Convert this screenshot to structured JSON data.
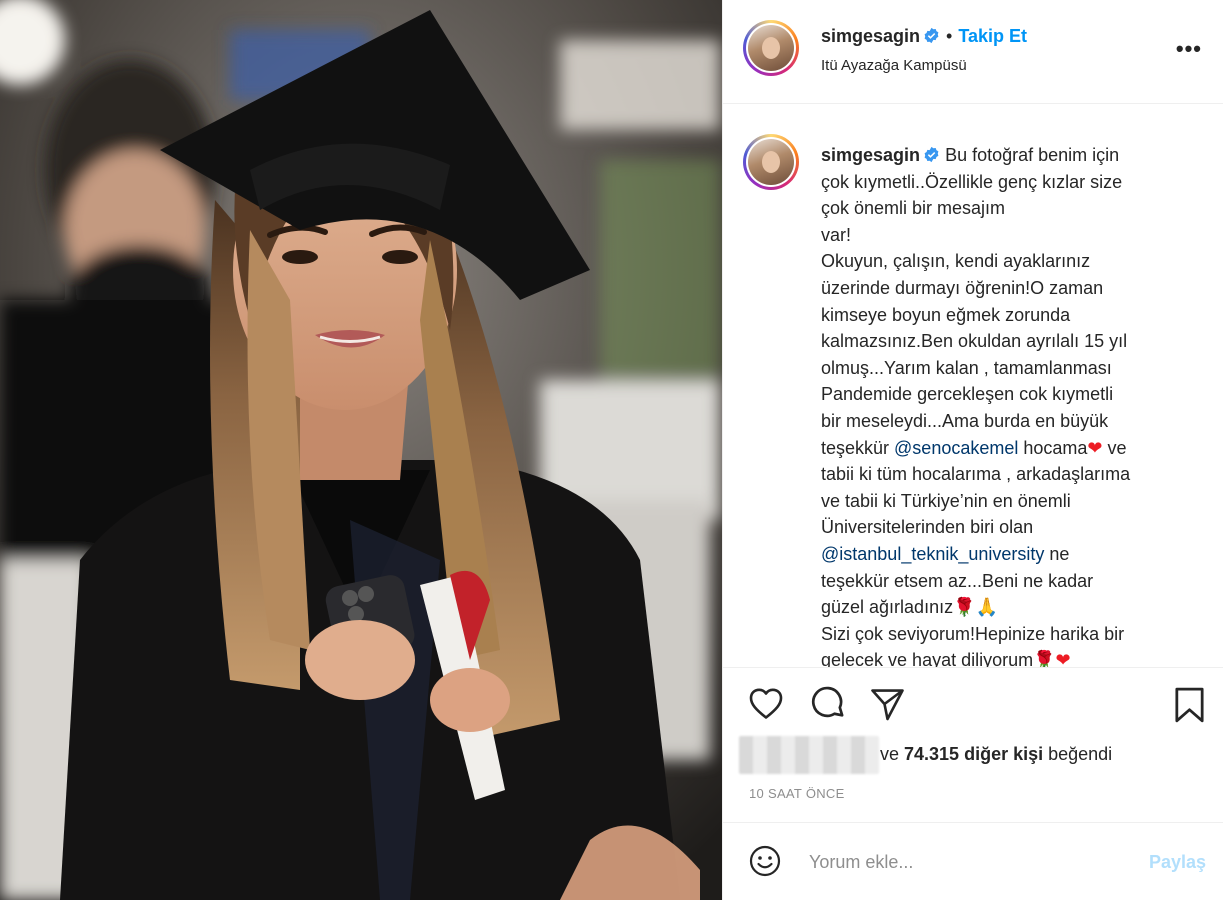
{
  "post": {
    "username": "simgesagin",
    "verified": true,
    "dot": "•",
    "follow_label": "Takip Et",
    "location": "Itü Ayazağa Kampüsü",
    "more_label": "•••"
  },
  "caption": {
    "username": "simgesagin",
    "text_1": "Bu fotoğraf benim için\nçok kıymetli..Özellikle genç kızlar size\nçok önemli bir mesajım\nvar!\nOkuyun, çalışın, kendi ayaklarınız\nüzerinde durmayı öğrenin!O zaman\nkimseye boyun eğmek zorunda\nkalmazsınız.Ben okuldan ayrılalı 15 yıl\nolmuş...Yarım kalan , tamamlanması\nPandemide gercekleşen cok kıymetli\nbir meseleydi...Ama burda en büyük\nteşekkür ",
    "mention_1": "@senocakemel",
    "text_2": " hocama",
    "heart_1": "❤",
    "text_3": " ve\ntabii ki tüm hocalarıma , arkadaşlarıma\nve tabii ki Türkiye’nin en önemli\nÜniversitelerinden biri olan\n",
    "mention_2": "@istanbul_teknik_university",
    "text_4": " ne\nteşekkür etsem az...Beni ne kadar\ngüzel ağırladınız🌹🙏\nSizi çok seviyorum!Hepinize harika bir\ngelecek ve hayat diliyorum🌹",
    "heart_2": "❤"
  },
  "likes": {
    "prefix": "ve ",
    "count": "74.315 diğer kişi",
    "suffix": " beğendi"
  },
  "time": "10 SAAT ÖNCE",
  "comment": {
    "placeholder": "Yorum ekle...",
    "share_label": "Paylaş"
  },
  "colors": {
    "accent": "#0095f6",
    "share_disabled": "#b2dffc",
    "mention": "#00376b",
    "heart": "#ed1c24",
    "muted": "#8e8e8e"
  },
  "icons": [
    "like-icon",
    "comment-icon",
    "share-icon",
    "save-icon",
    "emoji-icon",
    "verified-icon"
  ]
}
